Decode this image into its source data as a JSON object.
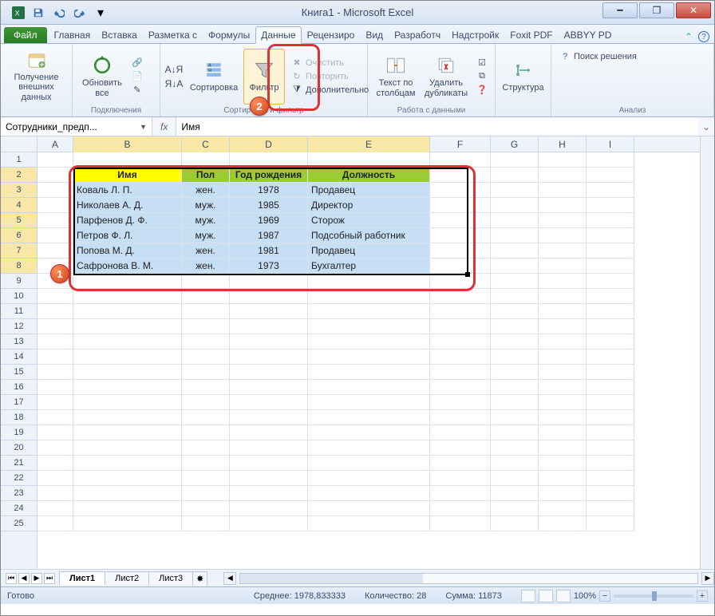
{
  "window": {
    "title": "Книга1 - Microsoft Excel"
  },
  "qat": {
    "save": "save-icon",
    "undo": "undo-icon",
    "redo": "redo-icon"
  },
  "tabs": {
    "file": "Файл",
    "items": [
      "Главная",
      "Вставка",
      "Разметка с",
      "Формулы",
      "Данные",
      "Рецензиро",
      "Вид",
      "Разработч",
      "Надстройк",
      "Foxit PDF",
      "ABBYY PD"
    ],
    "active_index": 4
  },
  "ribbon": {
    "group_ext": {
      "btn": "Получение\nвнешних данных"
    },
    "group_conn": {
      "refresh": "Обновить\nвсе",
      "label": "Подключения"
    },
    "group_sort": {
      "sort": "Сортировка",
      "filter": "Фильтр",
      "clear": "Очистить",
      "reapply": "Повторить",
      "advanced": "Дополнительно",
      "label": "Сортировка и фильтр"
    },
    "group_datatools": {
      "text_to_cols": "Текст по\nстолбцам",
      "dedup": "Удалить\nдубликаты",
      "label": "Работа с данными"
    },
    "group_outline": {
      "btn": "Структура"
    },
    "group_analysis": {
      "solver": "Поиск решения",
      "label": "Анализ"
    }
  },
  "formula_bar": {
    "namebox": "Сотрудники_предп...",
    "fx": "fx",
    "value": "Имя"
  },
  "columns": [
    "A",
    "B",
    "C",
    "D",
    "E",
    "F",
    "G",
    "H",
    "I"
  ],
  "row_count": 25,
  "table": {
    "headers": [
      "Имя",
      "Пол",
      "Год рождения",
      "Должность"
    ],
    "rows": [
      [
        "Коваль Л. П.",
        "жен.",
        "1978",
        "Продавец"
      ],
      [
        "Николаев А. Д.",
        "муж.",
        "1985",
        "Директор"
      ],
      [
        "Парфенов Д. Ф.",
        "муж.",
        "1969",
        "Сторож"
      ],
      [
        "Петров Ф. Л.",
        "муж.",
        "1987",
        "Подсобный работник"
      ],
      [
        "Попова М. Д.",
        "жен.",
        "1981",
        "Продавец"
      ],
      [
        "Сафронова В. М.",
        "жен.",
        "1973",
        "Бухгалтер"
      ]
    ]
  },
  "sheet_tabs": {
    "tabs": [
      "Лист1",
      "Лист2",
      "Лист3"
    ],
    "active": 0
  },
  "statusbar": {
    "ready": "Готово",
    "avg_label": "Среднее:",
    "avg_value": "1978,833333",
    "count_label": "Количество:",
    "count_value": "28",
    "sum_label": "Сумма:",
    "sum_value": "11873",
    "zoom": "100%"
  },
  "callouts": {
    "one": "1",
    "two": "2"
  }
}
